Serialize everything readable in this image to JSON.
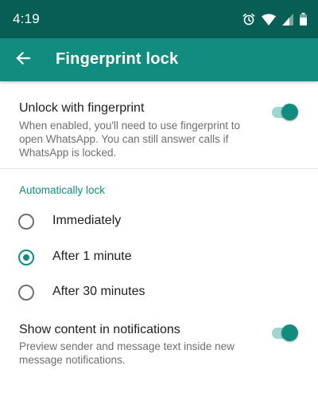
{
  "status_bar": {
    "time": "4:19",
    "icons": [
      "alarm-icon",
      "wifi-icon",
      "cellular-signal-icon",
      "battery-icon"
    ]
  },
  "app_bar": {
    "title": "Fingerprint lock",
    "back_icon": "arrow-back-icon"
  },
  "unlock": {
    "title": "Unlock with fingerprint",
    "description": "When enabled, you'll need to use fingerprint to open WhatsApp. You can still answer calls if WhatsApp is locked.",
    "enabled": true
  },
  "auto_lock": {
    "header": "Automatically lock",
    "options": [
      {
        "label": "Immediately",
        "selected": false
      },
      {
        "label": "After 1 minute",
        "selected": true
      },
      {
        "label": "After 30 minutes",
        "selected": false
      }
    ]
  },
  "notifications": {
    "title": "Show content in notifications",
    "description": "Preview sender and message text inside new message notifications.",
    "enabled": true
  },
  "colors": {
    "status_bar": "#075e54",
    "app_bar": "#128c7e",
    "accent": "#128c7e",
    "toggle_track": "#9fd7cf"
  }
}
